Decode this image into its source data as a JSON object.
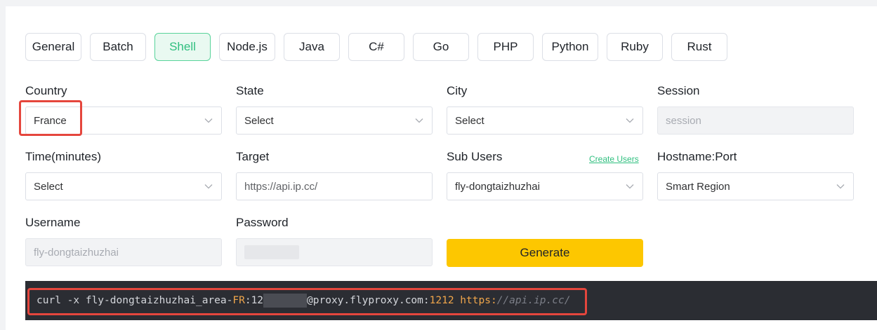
{
  "tabs": [
    "General",
    "Batch",
    "Shell",
    "Node.js",
    "Java",
    "C#",
    "Go",
    "PHP",
    "Python",
    "Ruby",
    "Rust"
  ],
  "active_tab": "Shell",
  "form": {
    "country": {
      "label": "Country",
      "value": "France"
    },
    "state": {
      "label": "State",
      "value": "Select"
    },
    "city": {
      "label": "City",
      "value": "Select"
    },
    "session": {
      "label": "Session",
      "placeholder": "session"
    },
    "time": {
      "label": "Time(minutes)",
      "value": "Select"
    },
    "target": {
      "label": "Target",
      "value": "https://api.ip.cc/"
    },
    "sub_users": {
      "label": "Sub Users",
      "value": "fly-dongtaizhuzhai",
      "link": "Create Users"
    },
    "hostname": {
      "label": "Hostname:Port",
      "value": "Smart Region"
    },
    "username": {
      "label": "Username",
      "value": "fly-dongtaizhuzhai"
    },
    "password": {
      "label": "Password"
    }
  },
  "generate_label": "Generate",
  "command": {
    "prefix": "curl -x fly-dongtaizhuzhai_area-",
    "area": "FR",
    "sep": ":",
    "pwd_start": "12",
    "host_part": "@proxy.flyproxy.com:",
    "port": "1212",
    "space": " ",
    "scheme": "https:",
    "url_rest": "//api.ip.cc/"
  },
  "colors": {
    "accent": "#2fbf7f",
    "button": "#fdc700",
    "highlight": "#e5463d"
  }
}
